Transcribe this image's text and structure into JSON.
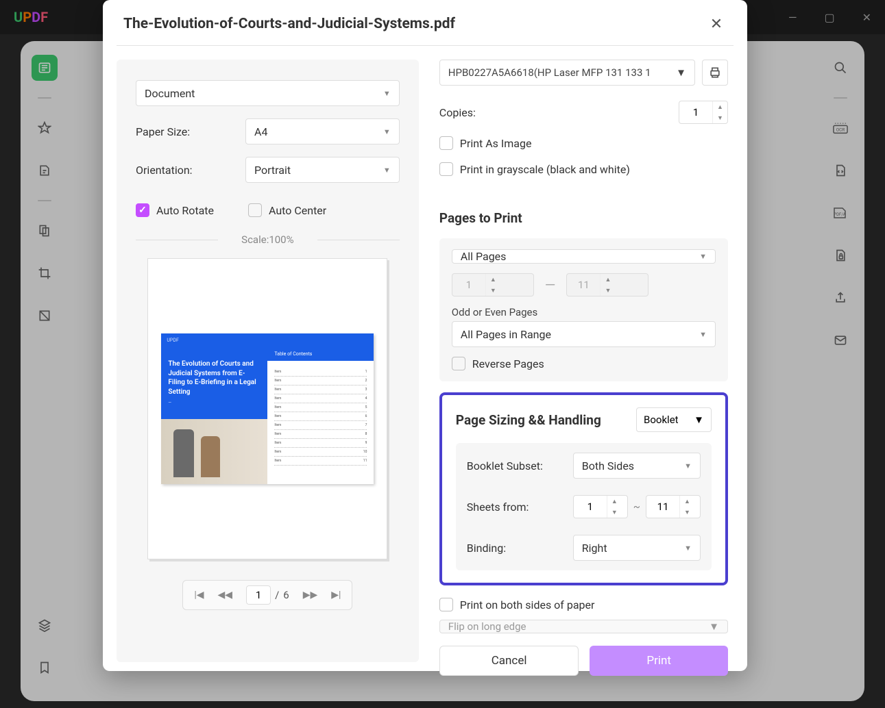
{
  "app": {
    "logo": "UPDF"
  },
  "window_buttons": {
    "min": "—",
    "max": "▢",
    "close": "✕"
  },
  "modal": {
    "title": "The-Evolution-of-Courts-and-Judicial-Systems.pdf",
    "left": {
      "mode": "Document",
      "paper_size_label": "Paper Size:",
      "paper_size": "A4",
      "orientation_label": "Orientation:",
      "orientation": "Portrait",
      "auto_rotate": "Auto Rotate",
      "auto_center": "Auto Center",
      "scale": "Scale:100%",
      "preview": {
        "brand": "UPDF",
        "title": "The Evolution of Courts and Judicial Systems from E-Filing to E-Briefing in a Legal Setting",
        "subtitle": "—",
        "toc_head": "Table of Contents"
      },
      "pager": {
        "current": "1",
        "sep": "/",
        "total": "6"
      }
    },
    "right": {
      "printer": "HPB0227A5A6618(HP Laser MFP 131 133 1",
      "copies_label": "Copies:",
      "copies": "1",
      "print_as_image": "Print As Image",
      "print_grayscale": "Print in grayscale (black and white)",
      "pages_to_print_title": "Pages to Print",
      "all_pages": "All Pages",
      "range_from": "1",
      "range_to": "11",
      "odd_even_label": "Odd or Even Pages",
      "odd_even": "All Pages in Range",
      "reverse_pages": "Reverse Pages",
      "sizing_title": "Page Sizing && Handling",
      "sizing_mode": "Booklet",
      "booklet_subset_label": "Booklet Subset:",
      "booklet_subset": "Both Sides",
      "sheets_from_label": "Sheets from:",
      "sheets_from": "1",
      "sheets_to": "11",
      "binding_label": "Binding:",
      "binding": "Right",
      "print_both_sides": "Print on both sides of paper",
      "flip": "Flip on long edge",
      "cancel": "Cancel",
      "print": "Print"
    }
  }
}
